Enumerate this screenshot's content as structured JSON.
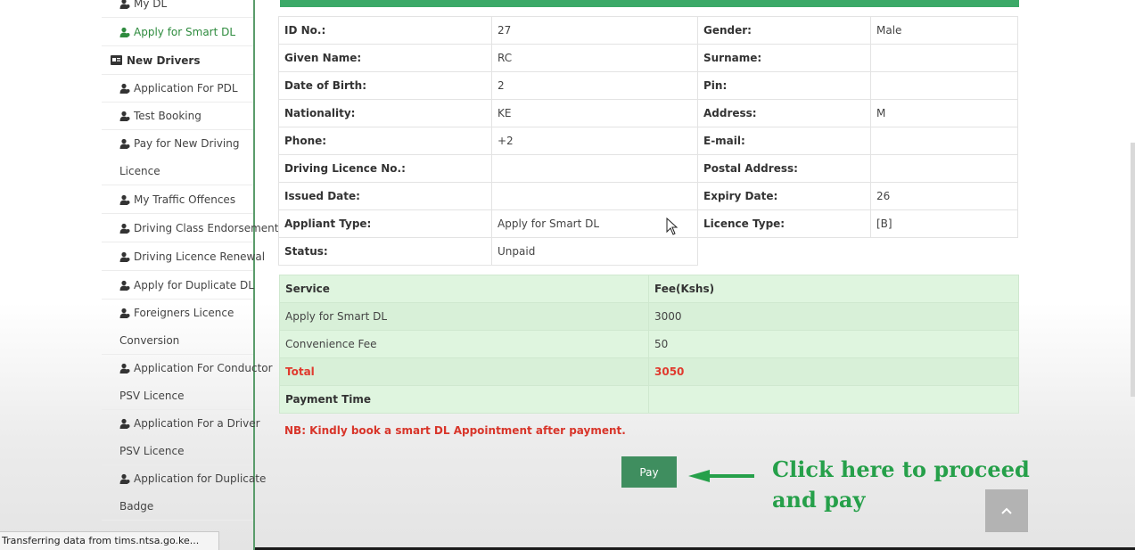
{
  "sidebar": {
    "items": [
      {
        "label": "My DL"
      },
      {
        "label": "Apply for Smart DL"
      },
      {
        "label": "New Drivers"
      },
      {
        "label": "Application For PDL"
      },
      {
        "label": "Test Booking"
      },
      {
        "label": "Pay for New Driving",
        "label2": "Licence"
      },
      {
        "label": "My Traffic Offences"
      },
      {
        "label": "Driving Class Endorsement"
      },
      {
        "label": "Driving Licence Renewal"
      },
      {
        "label": "Apply for Duplicate DL"
      },
      {
        "label": "Foreigners Licence",
        "label2": "Conversion"
      },
      {
        "label": "Application For Conductor",
        "label2": "PSV Licence"
      },
      {
        "label": "Application For a Driver",
        "label2": "PSV Licence"
      },
      {
        "label": "Application for Duplicate",
        "label2": "Badge"
      }
    ]
  },
  "details": {
    "rows": [
      {
        "l1": "ID No.:",
        "v1": "27",
        "l2": "Gender:",
        "v2": "Male"
      },
      {
        "l1": "Given Name:",
        "v1": "RC",
        "l2": "Surname:",
        "v2": ""
      },
      {
        "l1": "Date of Birth:",
        "v1": "2",
        "l2": "Pin:",
        "v2": ""
      },
      {
        "l1": "Nationality:",
        "v1": "KE",
        "l2": "Address:",
        "v2": "M"
      },
      {
        "l1": "Phone:",
        "v1": "+2",
        "l2": "E-mail:",
        "v2": ""
      },
      {
        "l1": "Driving Licence No.:",
        "v1": "",
        "l2": "Postal Address:",
        "v2": ""
      },
      {
        "l1": "Issued Date:",
        "v1": "",
        "l2": "Expiry Date:",
        "v2": "26"
      },
      {
        "l1": "Appliant Type:",
        "v1": "Apply for Smart DL",
        "l2": "Licence Type:",
        "v2": "[B]"
      },
      {
        "l1": "Status:",
        "v1": "Unpaid"
      }
    ]
  },
  "fees": {
    "header_service": "Service",
    "header_fee": "Fee(Kshs)",
    "rows": [
      {
        "service": "Apply for Smart DL",
        "fee": "3000"
      },
      {
        "service": "Convenience Fee",
        "fee": "50"
      }
    ],
    "total_label": "Total",
    "total_value": "3050",
    "payment_time_label": "Payment Time",
    "payment_time_value": ""
  },
  "note": "NB: Kindly book a smart DL Appointment after payment.",
  "pay_button": "Pay",
  "annotation": "Click here to proceed and pay",
  "status_bar": "Transferring data from tims.ntsa.go.ke...",
  "colors": {
    "accent": "#3ca968",
    "pay_button": "#3f8e5f",
    "annotation": "#26a04a",
    "warning": "#d8352a",
    "fee_table_bg": "#dff5df"
  }
}
